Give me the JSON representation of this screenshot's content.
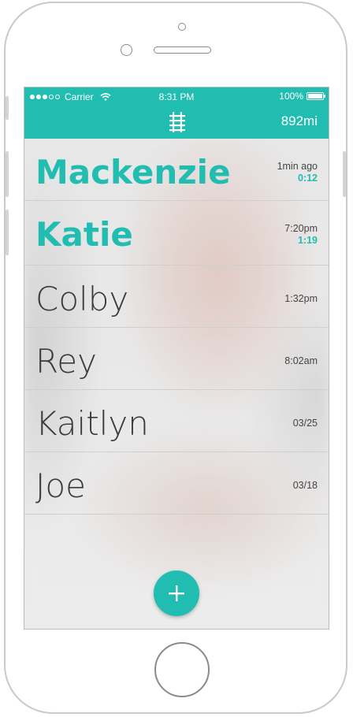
{
  "status_bar": {
    "carrier": "Carrier",
    "time": "8:31 PM",
    "battery": "100%"
  },
  "header": {
    "icon": "railroad-track-icon",
    "distance": "892mi"
  },
  "conversations": [
    {
      "name": "Mackenzie",
      "time": "1min ago",
      "duration": "0:12",
      "unread": true
    },
    {
      "name": "Katie",
      "time": "7:20pm",
      "duration": "1:19",
      "unread": true
    },
    {
      "name": "Colby",
      "time": "1:32pm",
      "duration": "",
      "unread": false
    },
    {
      "name": "Rey",
      "time": "8:02am",
      "duration": "",
      "unread": false
    },
    {
      "name": "Kaitlyn",
      "time": "03/25",
      "duration": "",
      "unread": false
    },
    {
      "name": "Joe",
      "time": "03/18",
      "duration": "",
      "unread": false
    }
  ],
  "fab": {
    "icon": "plus-icon"
  },
  "colors": {
    "accent": "#20bdb0",
    "text": "#3a3a3a"
  }
}
